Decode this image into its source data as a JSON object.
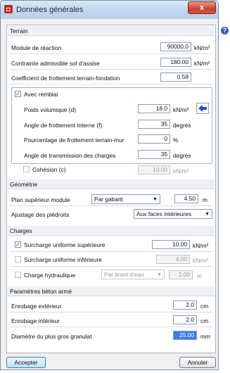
{
  "window": {
    "title": "Données générales",
    "close_label": "x",
    "help_label": "?"
  },
  "terrain": {
    "header": "Terrain",
    "module": {
      "label": "Module de réaction",
      "value": "90000.0",
      "unit": "kN/m³"
    },
    "contrainte": {
      "label": "Contrainte admissible sol d'assise",
      "value": "180.00",
      "unit": "kN/m²"
    },
    "frottement": {
      "label": "Coefficient de frottement terrain-fondation",
      "value": "0.58"
    },
    "remblai": {
      "label": "Avec remblai",
      "checked": true,
      "poids": {
        "label": "Poids volumique (d)",
        "value": "18.0",
        "unit": "kN/m³"
      },
      "angle_frot": {
        "label": "Angle de frottement interne (f)",
        "value": "35",
        "unit": "degrés"
      },
      "pourcentage": {
        "label": "Pourcentage de frottement terrain-mur",
        "value": "0",
        "unit": "%"
      },
      "angle_trans": {
        "label": "Angle de transmission des charges",
        "value": "35",
        "unit": "degrés"
      },
      "cohesion": {
        "label": "Cohésion (c)",
        "checked": false,
        "value": "10.00",
        "unit": "kN/m²"
      }
    }
  },
  "geometrie": {
    "header": "Géométrie",
    "plan": {
      "label": "Plan supérieur module",
      "selected": "Par gabarit",
      "value": "4.50",
      "unit": "m"
    },
    "ajustage": {
      "label": "Ajustage des piédroits",
      "selected": "Aux faces intérieures"
    }
  },
  "charges": {
    "header": "Charges",
    "sup": {
      "label": "Surcharge uniforme supérieure",
      "checked": true,
      "value": "10.00",
      "unit": "kN/m²"
    },
    "inf": {
      "label": "Surcharge uniforme inférieure",
      "checked": false,
      "value": "4.00",
      "unit": "kN/m²"
    },
    "hydro": {
      "label": "Charge hydraulique",
      "checked": false,
      "selected": "Par tirant d'eau",
      "value": "2.00",
      "unit": "m"
    }
  },
  "beton": {
    "header": "Paramètres béton armé",
    "ext": {
      "label": "Enrobage extérieur",
      "value": "2.0",
      "unit": "cm"
    },
    "int": {
      "label": "Enrobage intérieur",
      "value": "2.0",
      "unit": "cm"
    },
    "diam": {
      "label": "Diamètre du plus gros granulat",
      "value": "25.00",
      "unit": "mm"
    }
  },
  "footer": {
    "accept": "Accepter",
    "cancel": "Annuler"
  }
}
